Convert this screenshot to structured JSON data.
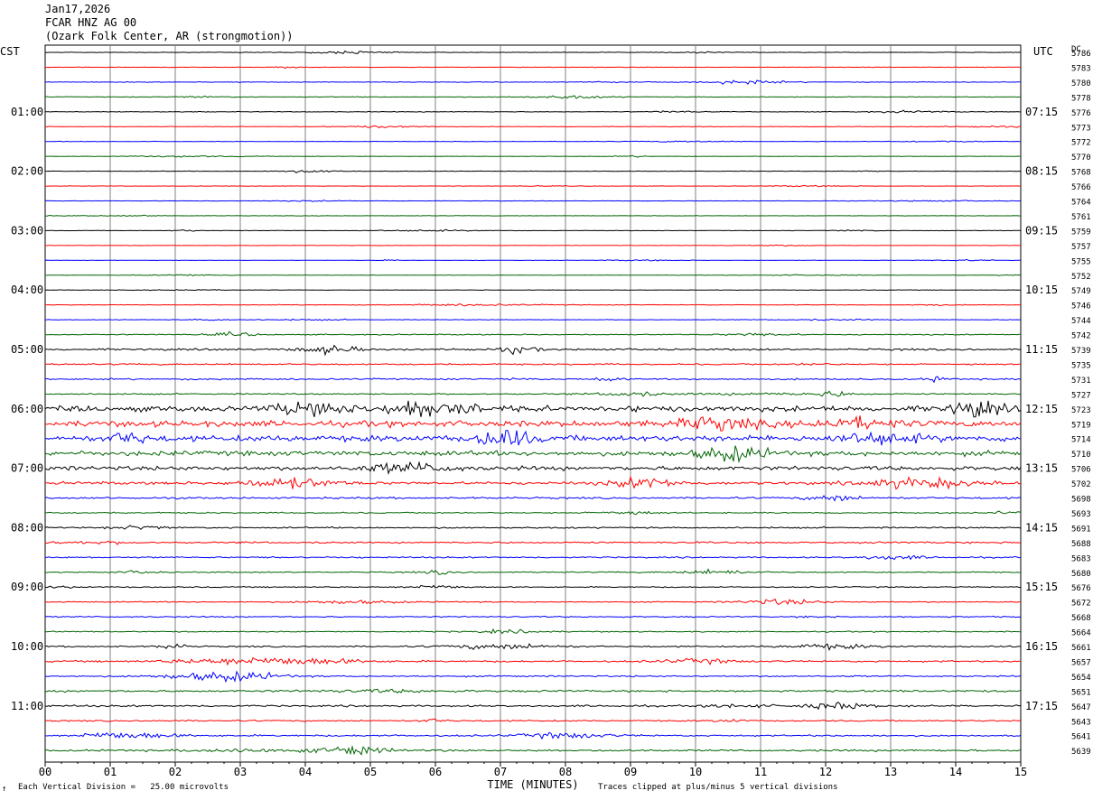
{
  "header": {
    "date": "Jan17,2026",
    "station": "FCAR HNZ AG 00",
    "location": "(Ozark Folk Center, AR (strongmotion))"
  },
  "left_tz": "CST",
  "right_tz": "UTC",
  "dc_label": "DC",
  "footer": {
    "mark": "↑",
    "scale_note": "Each Vertical Division =   25.00 microvolts",
    "clip_note": "Traces clipped at plus/minus 5 vertical divisions"
  },
  "colors": {
    "trace": [
      "#000000",
      "#ff0000",
      "#0000ff",
      "#006400"
    ],
    "grid": "#808080"
  },
  "chart_data": {
    "type": "line",
    "title": "",
    "xlabel": "TIME (MINUTES)",
    "ylabel": "",
    "xlim": [
      0,
      15
    ],
    "x_ticks": [
      "00",
      "01",
      "02",
      "03",
      "04",
      "05",
      "06",
      "07",
      "08",
      "09",
      "10",
      "11",
      "12",
      "13",
      "14",
      "15"
    ],
    "left_time_labels": [
      "01:00",
      "02:00",
      "03:00",
      "04:00",
      "05:00",
      "06:00",
      "07:00",
      "08:00",
      "09:00",
      "10:00",
      "11:00"
    ],
    "right_time_labels": [
      "07:15",
      "08:15",
      "09:15",
      "10:15",
      "11:15",
      "12:15",
      "13:15",
      "14:15",
      "15:15",
      "16:15",
      "17:15"
    ],
    "rows_per_label": 4,
    "dc_values": [
      5786,
      5783,
      5780,
      5778,
      5776,
      5773,
      5772,
      5770,
      5768,
      5766,
      5764,
      5761,
      5759,
      5757,
      5755,
      5752,
      5749,
      5746,
      5744,
      5742,
      5739,
      5735,
      5731,
      5727,
      5723,
      5719,
      5714,
      5710,
      5706,
      5702,
      5698,
      5693,
      5691,
      5688,
      5683,
      5680,
      5676,
      5672,
      5668,
      5664,
      5661,
      5657,
      5654,
      5651,
      5647,
      5643,
      5641,
      5639
    ],
    "activity": [
      0.3,
      0.25,
      0.35,
      0.35,
      0.35,
      0.3,
      0.25,
      0.2,
      0.25,
      0.2,
      0.2,
      0.2,
      0.25,
      0.2,
      0.2,
      0.2,
      0.25,
      0.35,
      0.3,
      0.6,
      1.0,
      0.8,
      0.8,
      0.7,
      3.0,
      3.2,
      3.2,
      2.6,
      2.2,
      1.5,
      1.0,
      0.7,
      0.8,
      0.9,
      0.8,
      0.6,
      0.6,
      0.6,
      0.7,
      0.6,
      0.8,
      0.9,
      0.8,
      1.1,
      1.0,
      0.8,
      0.9,
      1.0
    ]
  }
}
